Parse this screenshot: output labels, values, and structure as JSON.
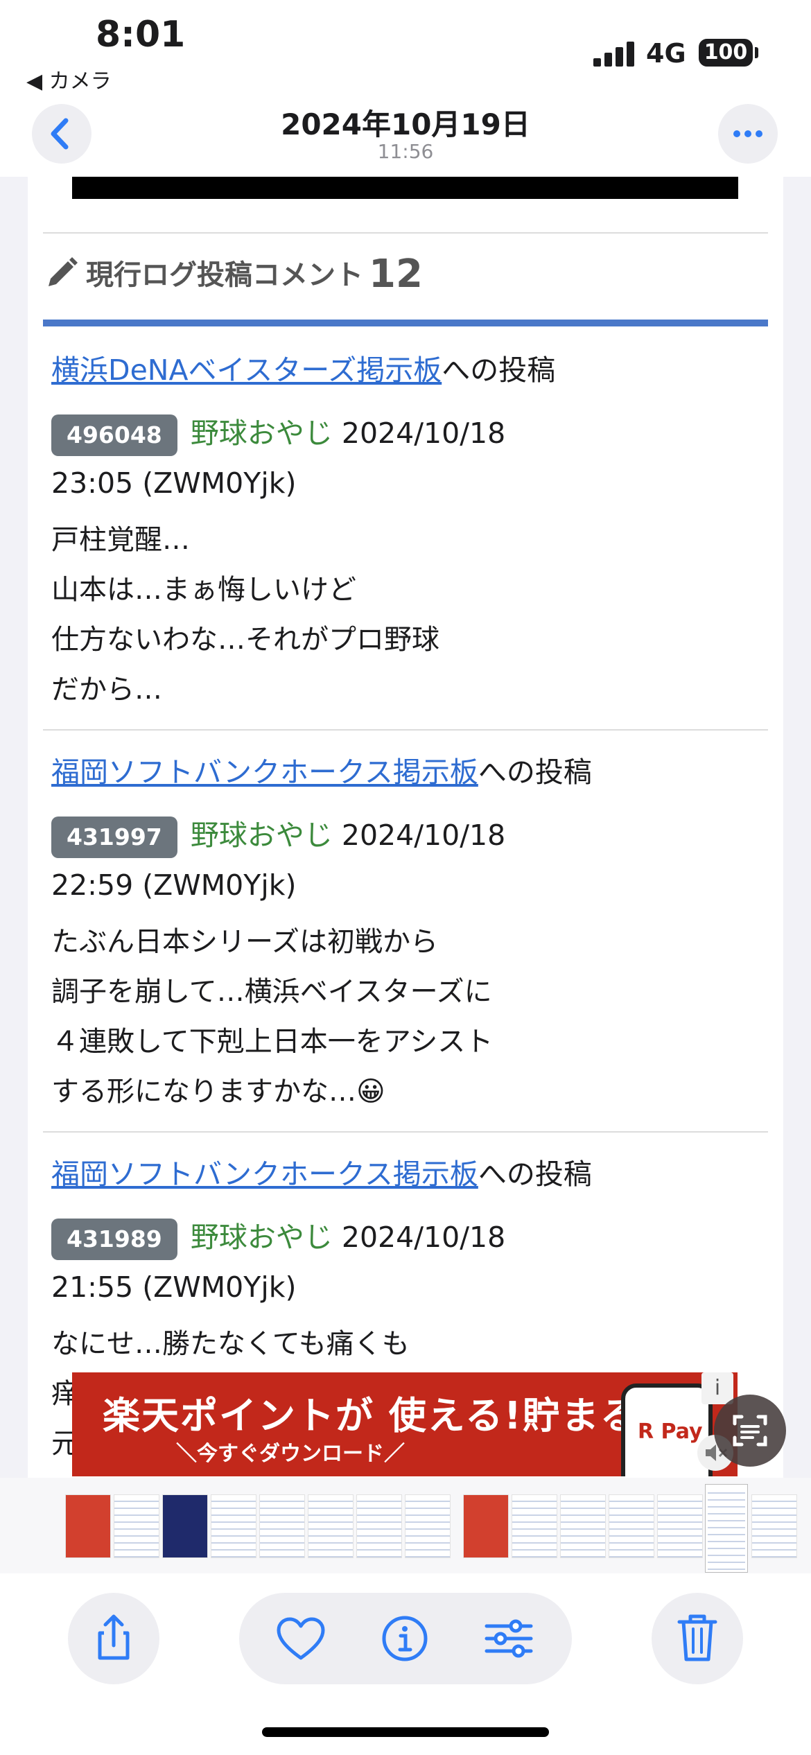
{
  "status_bar": {
    "time": "8:01",
    "back_app": "◀ カメラ",
    "network": "4G",
    "battery": "100"
  },
  "header": {
    "date": "2024年10月19日",
    "time": "11:56"
  },
  "section": {
    "title": "現行ログ投稿コメント",
    "count": "12"
  },
  "posts": [
    {
      "board_link": "横浜DeNAベイスターズ掲示板",
      "board_suffix": "への投稿",
      "id": "496048",
      "user": "野球おやじ",
      "date": "2024/10/18",
      "time_id": "23:05 (ZWM0Yjk)",
      "lines": [
        "戸柱覚醒…",
        "山本は…まぁ悔しいけど",
        "仕方ないわな…それがプロ野球",
        "だから…"
      ]
    },
    {
      "board_link": "福岡ソフトバンクホークス掲示板",
      "board_suffix": "への投稿",
      "id": "431997",
      "user": "野球おやじ",
      "date": "2024/10/18",
      "time_id": "22:59 (ZWM0Yjk)",
      "lines": [
        "たぶん日本シリーズは初戦から",
        "調子を崩して…横浜ベイスターズに",
        "４連敗して下剋上日本一をアシスト",
        "する形になりますかな…😀"
      ]
    },
    {
      "board_link": "福岡ソフトバンクホークス掲示板",
      "board_suffix": "への投稿",
      "id": "431989",
      "user": "野球おやじ",
      "date": "2024/10/18",
      "time_id": "21:55 (ZWM0Yjk)",
      "lines": [
        "なにせ…勝たなくても痛くも",
        "痒",
        "元"
      ]
    }
  ],
  "ad": {
    "headline": "楽天ポイントが 使える!貯まる!",
    "sub": "＼今すぐダウンロード／",
    "phone_brand": "R Pay",
    "info_icon": "i"
  },
  "colors": {
    "link": "#2e6cd1",
    "user": "#3c8a3c",
    "badge": "#6c757d",
    "section_rule": "#4a78c9",
    "ad_bg": "#c2281b",
    "ios_blue": "#2f7cf6"
  },
  "icons": [
    "chevron-left-icon",
    "more-icon",
    "pencil-icon",
    "share-icon",
    "heart-icon",
    "info-icon",
    "adjust-icon",
    "trash-icon",
    "live-text-icon",
    "mute-icon"
  ]
}
